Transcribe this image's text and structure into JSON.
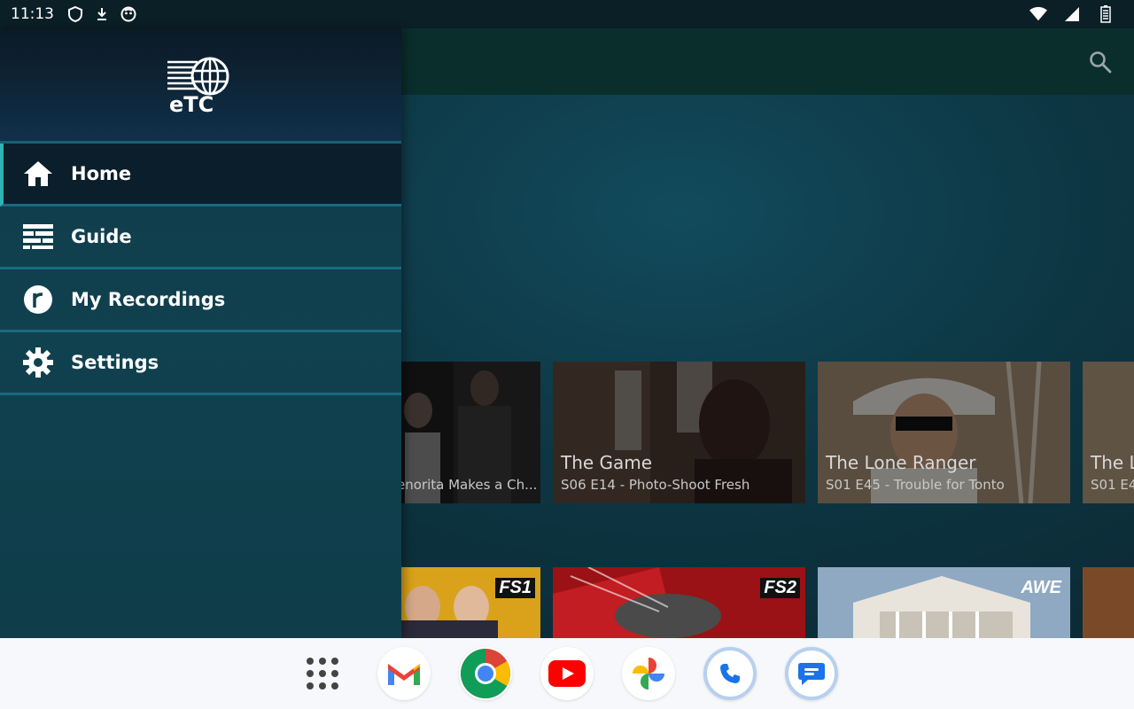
{
  "status": {
    "time": "11:13",
    "icons": [
      "shield-icon",
      "download-icon",
      "face-icon",
      "wifi-icon",
      "signal-icon",
      "battery-icon"
    ]
  },
  "drawer": {
    "logo_text": "eTC",
    "items": [
      {
        "label": "Home",
        "icon": "home-icon",
        "active": true
      },
      {
        "label": "Guide",
        "icon": "guide-icon",
        "active": false
      },
      {
        "label": "My Recordings",
        "icon": "recordings-icon",
        "active": false
      },
      {
        "label": "Settings",
        "icon": "gear-icon",
        "active": false
      }
    ]
  },
  "recordings": [
    {
      "title": "",
      "subtitle": "enorita Makes a Ch...",
      "bg": "#2c2c2c"
    },
    {
      "title": "The Game",
      "subtitle": "S06 E14 - Photo-Shoot Fresh",
      "bg": "#5a4638"
    },
    {
      "title": "The Lone Ranger",
      "subtitle": "S01 E45 - Trouble for Tonto",
      "bg": "#7a6a52"
    },
    {
      "title": "The L",
      "subtitle": "S01 E4",
      "bg": "#6a5a48"
    }
  ],
  "channels": [
    {
      "net": "FS1",
      "bg": "#d9a21a"
    },
    {
      "net": "FS2",
      "bg": "#b3161b"
    },
    {
      "net": "AWE",
      "bg": "#8fa3b8"
    },
    {
      "net": "",
      "bg": "#7a4a28"
    }
  ],
  "dock": {
    "apps": [
      "app-drawer",
      "gmail",
      "chrome",
      "youtube",
      "photos",
      "phone",
      "messages"
    ]
  },
  "colors": {
    "accent": "#2fb3b5",
    "drawer_bg": "#10414f",
    "dock_bg": "#f6f8fb"
  }
}
